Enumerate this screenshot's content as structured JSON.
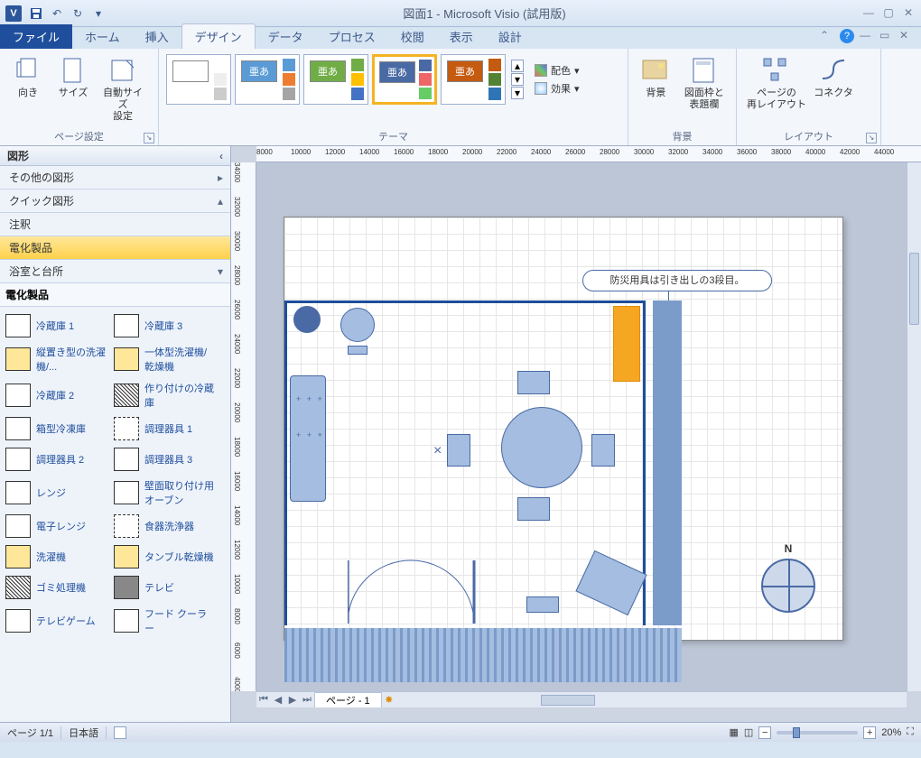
{
  "title": "図面1 - Microsoft Visio (試用版)",
  "qat": {
    "save": "H",
    "undo": "↶",
    "redo": "↻"
  },
  "tabs": {
    "file": "ファイル",
    "items": [
      "ホーム",
      "挿入",
      "デザイン",
      "データ",
      "プロセス",
      "校閲",
      "表示",
      "設計"
    ],
    "active_index": 2
  },
  "ribbon": {
    "pagesetup": {
      "label": "ページ設定",
      "orient": "向き",
      "size": "サイズ",
      "autosize": "自動サイズ\n設定"
    },
    "themes": {
      "label": "テーマ",
      "sample_text": "亜あ",
      "count": 5,
      "selected_index": 3,
      "color_opt": "配色",
      "effect_opt": "効果"
    },
    "background": {
      "label": "背景",
      "bg": "背景",
      "frame": "図面枠と\n表題欄"
    },
    "layout": {
      "label": "レイアウト",
      "relayout": "ページの\n再レイアウト",
      "connector": "コネクタ"
    }
  },
  "shapes": {
    "title": "図形",
    "other": "その他の図形",
    "quick": "クイック図形",
    "annot": "注釈",
    "electrical": "電化製品",
    "bath": "浴室と台所",
    "section": "電化製品",
    "items": [
      [
        "冷蔵庫 1",
        "冷蔵庫 3"
      ],
      [
        "縦置き型の洗濯機/...",
        "一体型洗濯機/乾燥機"
      ],
      [
        "冷蔵庫 2",
        "作り付けの冷蔵庫"
      ],
      [
        "箱型冷凍庫",
        "調理器具 1"
      ],
      [
        "調理器具 2",
        "調理器具 3"
      ],
      [
        "レンジ",
        "壁面取り付け用オーブン"
      ],
      [
        "電子レンジ",
        "食器洗浄器"
      ],
      [
        "洗濯機",
        "タンブル乾燥機"
      ],
      [
        "ゴミ処理機",
        "テレビ"
      ],
      [
        "テレビゲーム",
        "フード クーラー"
      ]
    ]
  },
  "canvas": {
    "callout": "防災用具は引き出しの3段目。",
    "compass": "N",
    "page_tab": "ページ - 1",
    "hruler": [
      "8000",
      "10000",
      "12000",
      "14000",
      "16000",
      "18000",
      "20000",
      "22000",
      "24000",
      "26000",
      "28000",
      "30000",
      "32000",
      "34000",
      "36000",
      "38000",
      "40000",
      "42000",
      "44000"
    ],
    "vruler": [
      "34000",
      "32000",
      "30000",
      "28000",
      "26000",
      "24000",
      "22000",
      "20000",
      "18000",
      "16000",
      "14000",
      "12000",
      "10000",
      "8000",
      "6000",
      "4000"
    ]
  },
  "status": {
    "page": "ページ 1/1",
    "lang": "日本語",
    "zoom": "20%"
  }
}
